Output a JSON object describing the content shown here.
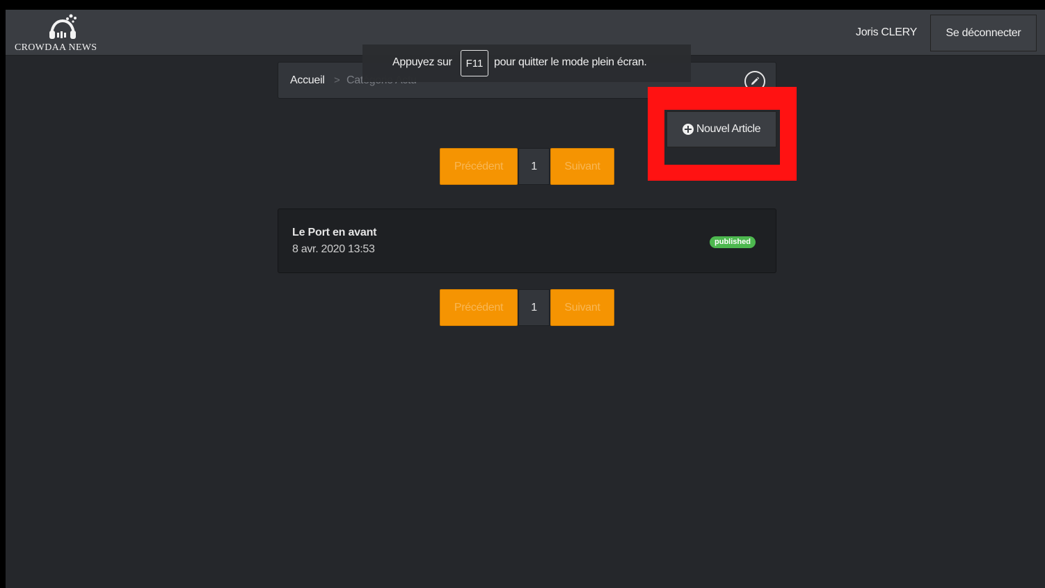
{
  "header": {
    "brand": "CROWDAA NEWS",
    "user_name": "Joris CLERY",
    "logout_label": "Se déconnecter"
  },
  "breadcrumb": {
    "home": "Accueil",
    "separator": ">",
    "current": "Catégorie Actu"
  },
  "fullscreen_notice": {
    "before": "Appuyez sur",
    "key": "F11",
    "after": "pour quitter le mode plein écran."
  },
  "actions": {
    "new_article_label": "Nouvel Article"
  },
  "pagination": {
    "prev_label": "Précédent",
    "page": "1",
    "next_label": "Suivant"
  },
  "articles": [
    {
      "title": "Le Port en avant",
      "date": "8 avr. 2020 13:53",
      "status": "published"
    }
  ],
  "colors": {
    "accent": "#f59402",
    "highlight": "#ff1212",
    "published_badge": "#4db84f",
    "background": "#25272b"
  },
  "icons": [
    "logo-headphones-icon",
    "pencil-icon",
    "plus-circle-icon"
  ]
}
